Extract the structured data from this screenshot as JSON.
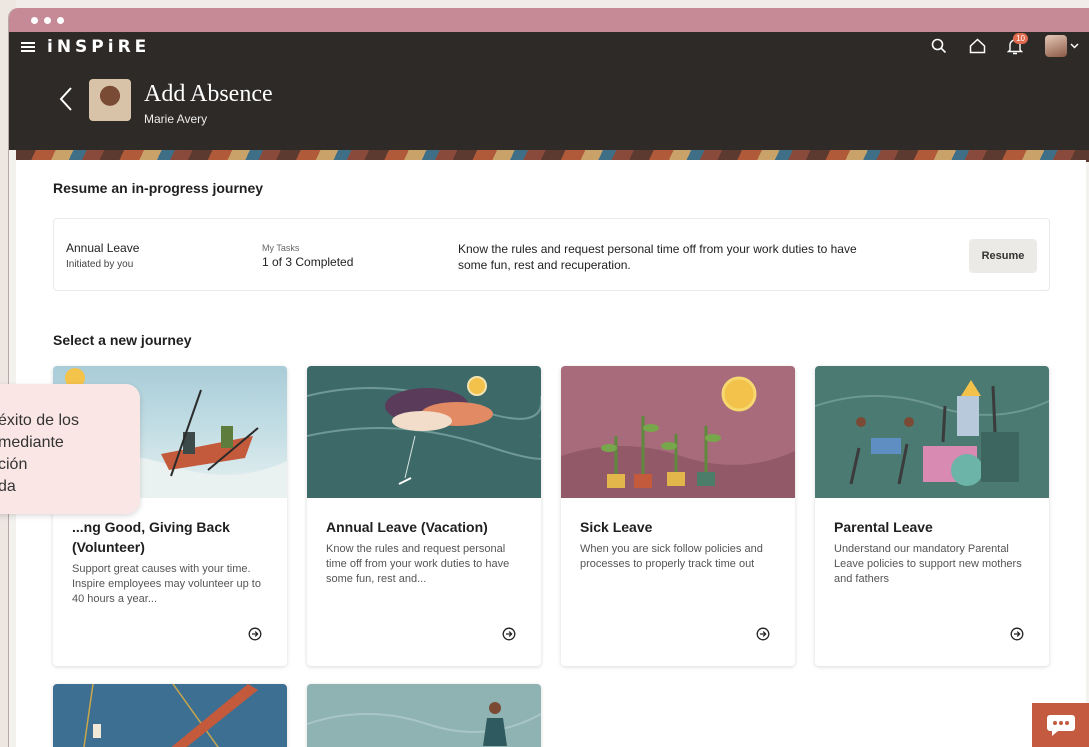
{
  "window": {
    "dots": 3
  },
  "appbar": {
    "brand": "iNSPiRE",
    "notification_count": "10"
  },
  "header": {
    "title": "Add Absence",
    "subtitle": "Marie Avery"
  },
  "resume_section": {
    "title": "Resume an in-progress journey",
    "card": {
      "name": "Annual Leave",
      "initiated": "Initiated by you",
      "tasks_label": "My Tasks",
      "tasks_value": "1 of 3 Completed",
      "description": "Know the rules and request personal time off from your work duties to have some fun, rest and recuperation.",
      "button_label": "Resume"
    }
  },
  "new_section": {
    "title": "Select a new journey",
    "cards": [
      {
        "title": "...ng Good, Giving Back (Volunteer)",
        "description": "Support great causes with your time. Inspire employees may volunteer up to 40 hours a year..."
      },
      {
        "title": "Annual Leave (Vacation)",
        "description": "Know the rules and request personal time off from your work duties to have some fun, rest and..."
      },
      {
        "title": "Sick Leave",
        "description": "When you are sick follow policies and processes to properly track time out"
      },
      {
        "title": "Parental Leave",
        "description": "Understand our mandatory Parental Leave policies to support new mothers and fathers"
      }
    ]
  },
  "popup": {
    "lines": [
      "éxito de los",
      "mediante",
      "ción",
      "da"
    ]
  },
  "colors": {
    "titlebar": "#c58a96",
    "appbar": "#2d2a28",
    "chat": "#c45b40",
    "popup": "#fbe6e6"
  }
}
